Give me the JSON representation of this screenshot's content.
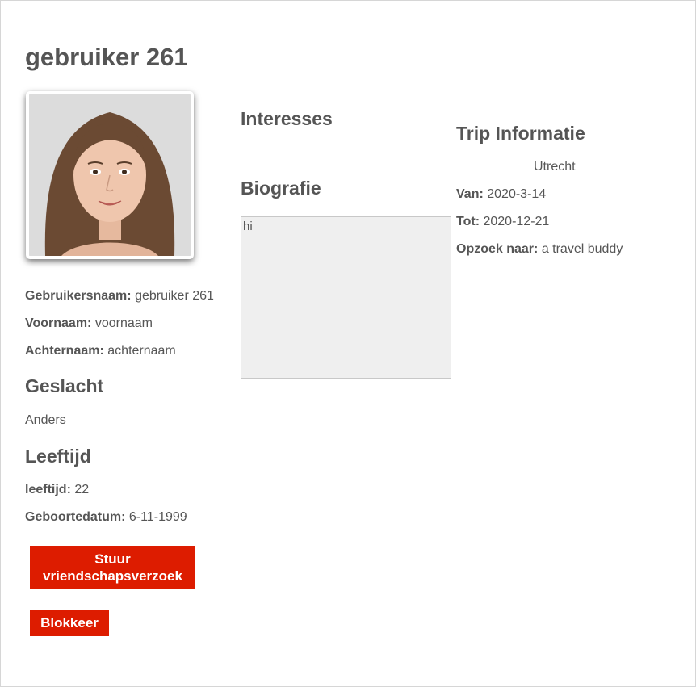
{
  "profile": {
    "title": "gebruiker 261",
    "avatar_alt": "Profielfoto",
    "username_label": "Gebruikersnaam:",
    "username_value": "gebruiker 261",
    "firstname_label": "Voornaam:",
    "firstname_value": "voornaam",
    "lastname_label": "Achternaam:",
    "lastname_value": "achternaam"
  },
  "gender": {
    "heading": "Geslacht",
    "value": "Anders"
  },
  "age": {
    "heading": "Leeftijd",
    "age_label": "leeftijd:",
    "age_value": "22",
    "birthdate_label": "Geboortedatum:",
    "birthdate_value": "6-11-1999"
  },
  "actions": {
    "friend_request_label": "Stuur vriendschapsverzoek",
    "block_label": "Blokkeer",
    "button_color": "#dd1c00"
  },
  "interests": {
    "heading": "Interesses"
  },
  "bio": {
    "heading": "Biografie",
    "text": "hi"
  },
  "trip": {
    "heading": "Trip Informatie",
    "city": "Utrecht",
    "from_label": "Van:",
    "from_value": "2020-3-14",
    "to_label": "Tot:",
    "to_value": "2020-12-21",
    "seeking_label": "Opzoek naar:",
    "seeking_value": "a travel buddy"
  }
}
